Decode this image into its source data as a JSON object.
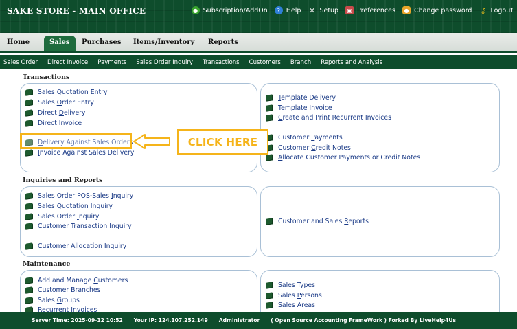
{
  "header": {
    "title": "SAKE STORE - MAIN OFFICE",
    "links": [
      {
        "label": "Subscription/AddOn",
        "icon": "globe-icon"
      },
      {
        "label": "Help",
        "icon": "help-icon"
      },
      {
        "label": "Setup",
        "icon": "tools-icon"
      },
      {
        "label": "Preferences",
        "icon": "preferences-icon"
      },
      {
        "label": "Change password",
        "icon": "lock-icon"
      },
      {
        "label": "Logout",
        "icon": "key-icon"
      }
    ]
  },
  "tabs": [
    {
      "u": "H",
      "rest": "ome"
    },
    {
      "u": "S",
      "rest": "ales"
    },
    {
      "u": "P",
      "rest": "urchases"
    },
    {
      "u": "I",
      "rest": "tems/Inventory"
    },
    {
      "u": "R",
      "rest": "eports"
    }
  ],
  "submenu": [
    "Sales Order",
    "Direct Invoice",
    "Payments",
    "Sales Order Inquiry",
    "Transactions",
    "Customers",
    "Branch",
    "Reports and Analysis"
  ],
  "sections": {
    "transactions": {
      "title": "Transactions",
      "left": [
        {
          "pre": "Sales ",
          "u": "Q",
          "post": "uotation Entry"
        },
        {
          "pre": "Sales ",
          "u": "O",
          "post": "rder Entry"
        },
        {
          "pre": "Direct ",
          "u": "D",
          "post": "elivery"
        },
        {
          "pre": "Direct ",
          "u": "I",
          "post": "nvoice"
        },
        {
          "pre": "",
          "u": "D",
          "post": "elivery Against Sales Orders"
        },
        {
          "pre": "",
          "u": "I",
          "post": "nvoice Against Sales Delivery"
        }
      ],
      "right": [
        {
          "pre": "",
          "u": "T",
          "post": "emplate Delivery"
        },
        {
          "pre": "",
          "u": "T",
          "post": "emplate Invoice"
        },
        {
          "pre": "",
          "u": "C",
          "post": "reate and Print Recurrent Invoices"
        },
        {
          "pre": "Customer ",
          "u": "P",
          "post": "ayments"
        },
        {
          "pre": "Customer ",
          "u": "C",
          "post": "redit Notes"
        },
        {
          "pre": "",
          "u": "A",
          "post": "llocate Customer Payments or Credit Notes"
        }
      ]
    },
    "inquiries": {
      "title": "Inquiries and Reports",
      "left": [
        {
          "pre": "Sales Order POS-Sales ",
          "u": "I",
          "post": "nquiry"
        },
        {
          "pre": "Sales Quotation I",
          "u": "n",
          "post": "quiry"
        },
        {
          "pre": "Sales Order ",
          "u": "I",
          "post": "nquiry"
        },
        {
          "pre": "Customer Transaction ",
          "u": "I",
          "post": "nquiry"
        },
        {
          "pre": "Customer Allocation ",
          "u": "I",
          "post": "nquiry"
        }
      ],
      "right": [
        {
          "pre": "Customer and Sales ",
          "u": "R",
          "post": "eports"
        }
      ]
    },
    "maintenance": {
      "title": "Maintenance",
      "left": [
        {
          "pre": "Add and Manage ",
          "u": "C",
          "post": "ustomers"
        },
        {
          "pre": "Customer ",
          "u": "B",
          "post": "ranches"
        },
        {
          "pre": "Sales ",
          "u": "G",
          "post": "roups"
        },
        {
          "pre": "Recurrent ",
          "u": "I",
          "post": "nvoices"
        }
      ],
      "right": [
        {
          "pre": "Sales T",
          "u": "y",
          "post": "pes"
        },
        {
          "pre": "Sales ",
          "u": "P",
          "post": "ersons"
        },
        {
          "pre": "Sales ",
          "u": "A",
          "post": "reas"
        }
      ]
    }
  },
  "callout": {
    "label": "CLICK HERE",
    "color": "#f5b41a"
  },
  "footer": {
    "server_time": "Server Time: 2025-09-12 10:52",
    "ip": "Your IP: 124.107.252.149",
    "user": "Administrator",
    "credit": "( Open Source Accounting FrameWork ) Forked By LiveHelp4Us"
  }
}
